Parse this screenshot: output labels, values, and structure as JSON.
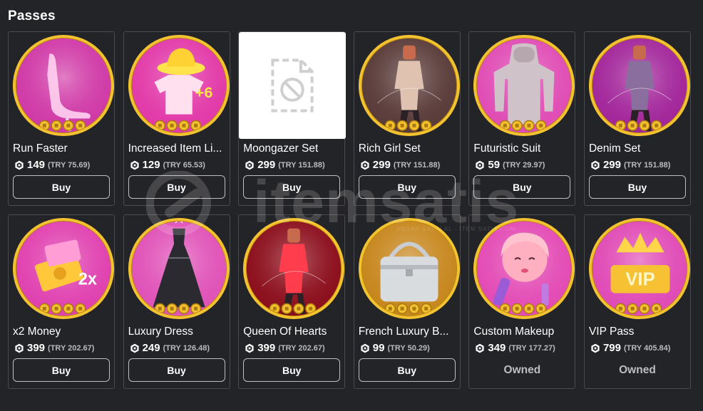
{
  "section": {
    "title": "Passes"
  },
  "watermark": {
    "text": "itemsatis",
    "subtext": "HESAP SATIN AL · İTEM SATIŞ.COM"
  },
  "currency": {
    "icon": "robux-icon"
  },
  "passes": [
    {
      "name": "Run Faster",
      "price": "149",
      "fiat": "(TRY 75.69)",
      "action": "Buy",
      "owned": false,
      "thumb": "high-heel-shoe",
      "bg": "#d03aa7",
      "accent": "#ffd1ef"
    },
    {
      "name": "Increased Item Li...",
      "price": "129",
      "fiat": "(TRY 65.53)",
      "action": "Buy",
      "owned": false,
      "thumb": "hat-and-shirt",
      "bg": "#e23aa9",
      "accent": "#ffe34d"
    },
    {
      "name": "Moongazer Set",
      "price": "299",
      "fiat": "(TRY 151.88)",
      "action": "Buy",
      "owned": false,
      "thumb": "placeholder",
      "bg": "#ffffff",
      "accent": "#cfcfcf"
    },
    {
      "name": "Rich Girl Set",
      "price": "299",
      "fiat": "(TRY 151.88)",
      "action": "Buy",
      "owned": false,
      "thumb": "avatar-outfit",
      "bg": "#5a3c3a",
      "accent": "#e0c2b0"
    },
    {
      "name": "Futuristic Suit",
      "price": "59",
      "fiat": "(TRY 29.97)",
      "action": "Buy",
      "owned": false,
      "thumb": "suit",
      "bg": "#e04db5",
      "accent": "#cfc3c9"
    },
    {
      "name": "Denim Set",
      "price": "299",
      "fiat": "(TRY 151.88)",
      "action": "Buy",
      "owned": false,
      "thumb": "avatar-outfit",
      "bg": "#a3279b",
      "accent": "#8a6f9e"
    },
    {
      "name": "x2 Money",
      "price": "399",
      "fiat": "(TRY 202.67)",
      "action": "Buy",
      "owned": false,
      "thumb": "money",
      "bg": "#e042b0",
      "accent": "#ffc73a"
    },
    {
      "name": "Luxury Dress",
      "price": "249",
      "fiat": "(TRY 126.48)",
      "action": "Buy",
      "owned": false,
      "thumb": "dress",
      "bg": "#e053b8",
      "accent": "#2a2a30"
    },
    {
      "name": "Queen Of Hearts",
      "price": "399",
      "fiat": "(TRY 202.67)",
      "action": "Buy",
      "owned": false,
      "thumb": "avatar-outfit",
      "bg": "#8c0f1d",
      "accent": "#ff3d4d"
    },
    {
      "name": "French Luxury B...",
      "price": "99",
      "fiat": "(TRY 50.29)",
      "action": "Buy",
      "owned": false,
      "thumb": "handbag",
      "bg": "#c7871f",
      "accent": "#d9dcdf"
    },
    {
      "name": "Custom Makeup",
      "price": "349",
      "fiat": "(TRY 177.27)",
      "action": "Owned",
      "owned": true,
      "thumb": "face",
      "bg": "#e34bb5",
      "accent": "#ffb8c6"
    },
    {
      "name": "VIP Pass",
      "price": "799",
      "fiat": "(TRY 405.84)",
      "action": "Owned",
      "owned": true,
      "thumb": "vip-crown",
      "bg": "#e04bb6",
      "accent": "#ffd54a"
    }
  ]
}
